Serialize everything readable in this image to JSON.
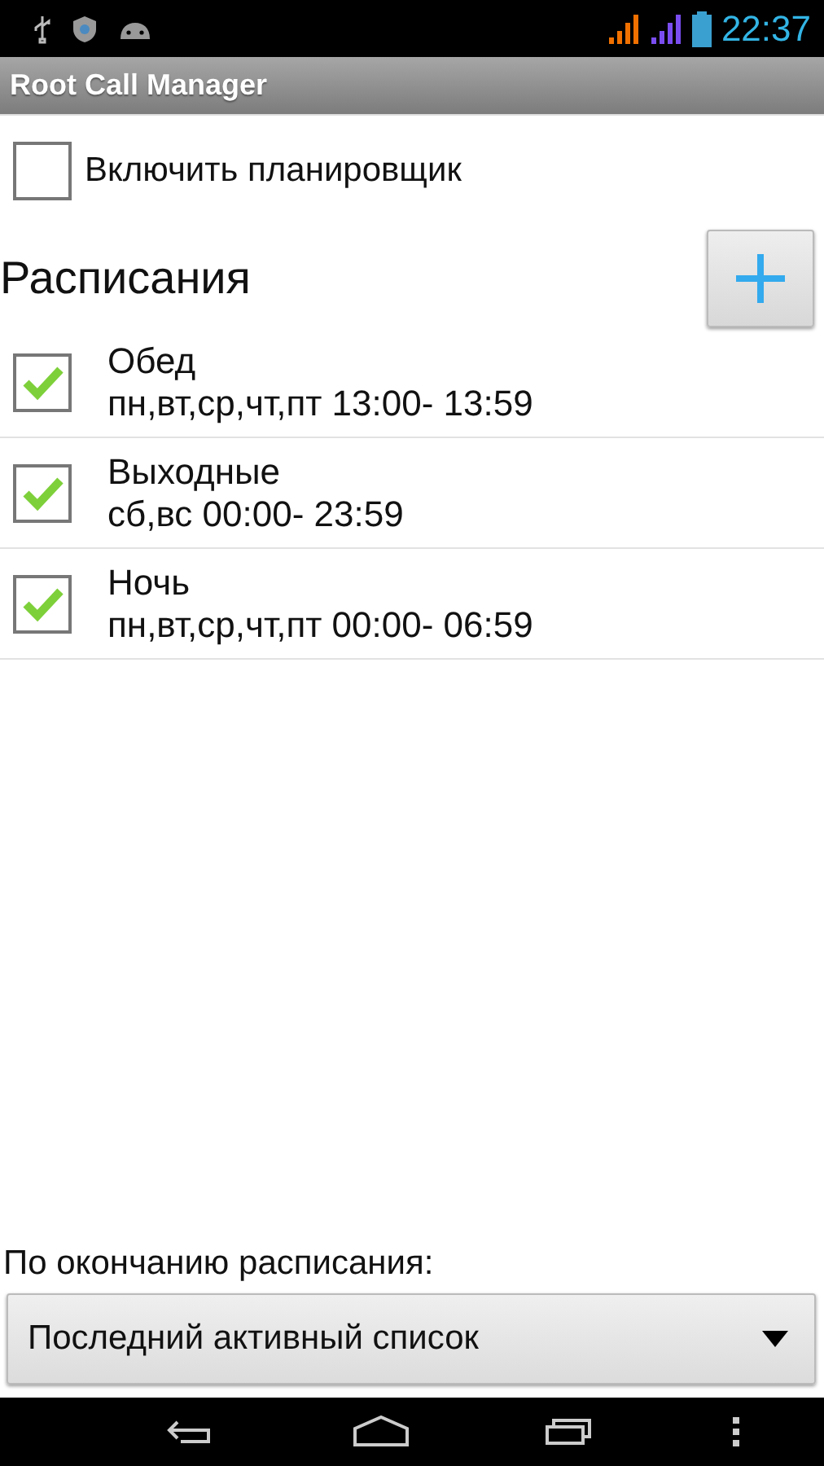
{
  "status_bar": {
    "time": "22:37"
  },
  "title_bar": {
    "title": "Root Call Manager"
  },
  "scheduler_toggle": {
    "label": "Включить планировщик",
    "checked": false
  },
  "schedules": {
    "heading": "Расписания",
    "items": [
      {
        "name": "Обед",
        "details": "пн,вт,ср,чт,пт 13:00- 13:59",
        "checked": true
      },
      {
        "name": "Выходные",
        "details": "сб,вс 00:00- 23:59",
        "checked": true
      },
      {
        "name": "Ночь",
        "details": "пн,вт,ср,чт,пт 00:00- 06:59",
        "checked": true
      }
    ]
  },
  "on_end": {
    "label": "По окончанию расписания:",
    "value": "Последний активный список"
  }
}
